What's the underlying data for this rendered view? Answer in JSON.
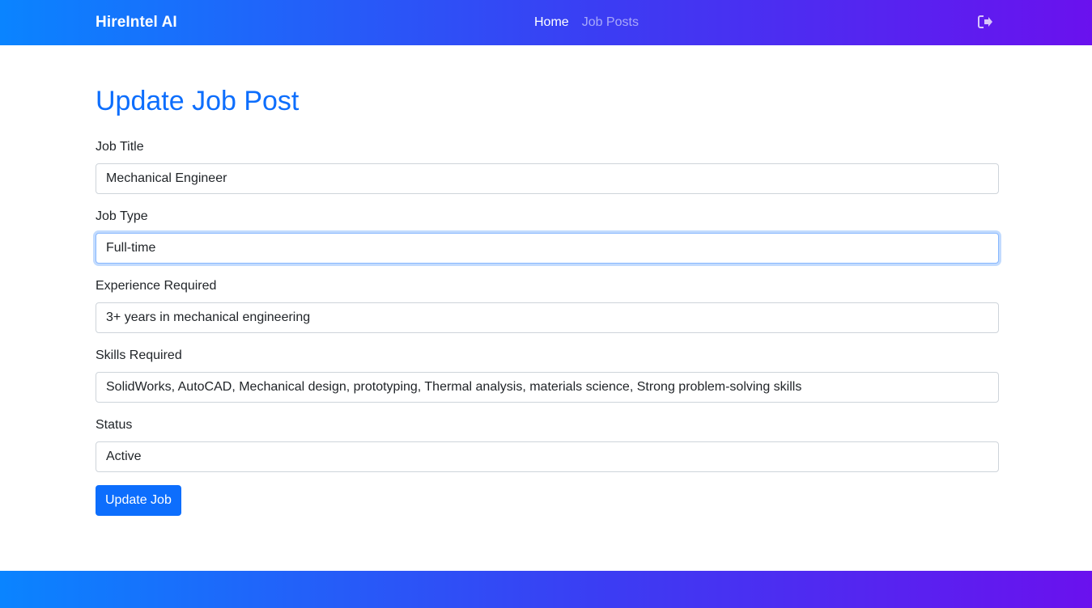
{
  "navbar": {
    "brand": "HireIntel AI",
    "links": [
      {
        "label": "Home",
        "active": true
      },
      {
        "label": "Job Posts",
        "active": false
      }
    ],
    "logout_icon": "sign-out-icon",
    "gradient_start": "#0a84ff",
    "gradient_end": "#6a11ee"
  },
  "page": {
    "title": "Update Job Post",
    "title_color": "#0d6efd"
  },
  "form": {
    "fields": [
      {
        "label": "Job Title",
        "value": "Mechanical Engineer",
        "focused": false
      },
      {
        "label": "Job Type",
        "value": "Full-time",
        "focused": true
      },
      {
        "label": "Experience Required",
        "value": "3+ years in mechanical engineering",
        "focused": false
      },
      {
        "label": "Skills Required",
        "value": "SolidWorks, AutoCAD, Mechanical design, prototyping, Thermal analysis, materials science, Strong problem-solving skills",
        "focused": false
      },
      {
        "label": "Status",
        "value": "Active",
        "focused": false
      }
    ],
    "submit_label": "Update Job",
    "accent": "#0d6efd"
  }
}
